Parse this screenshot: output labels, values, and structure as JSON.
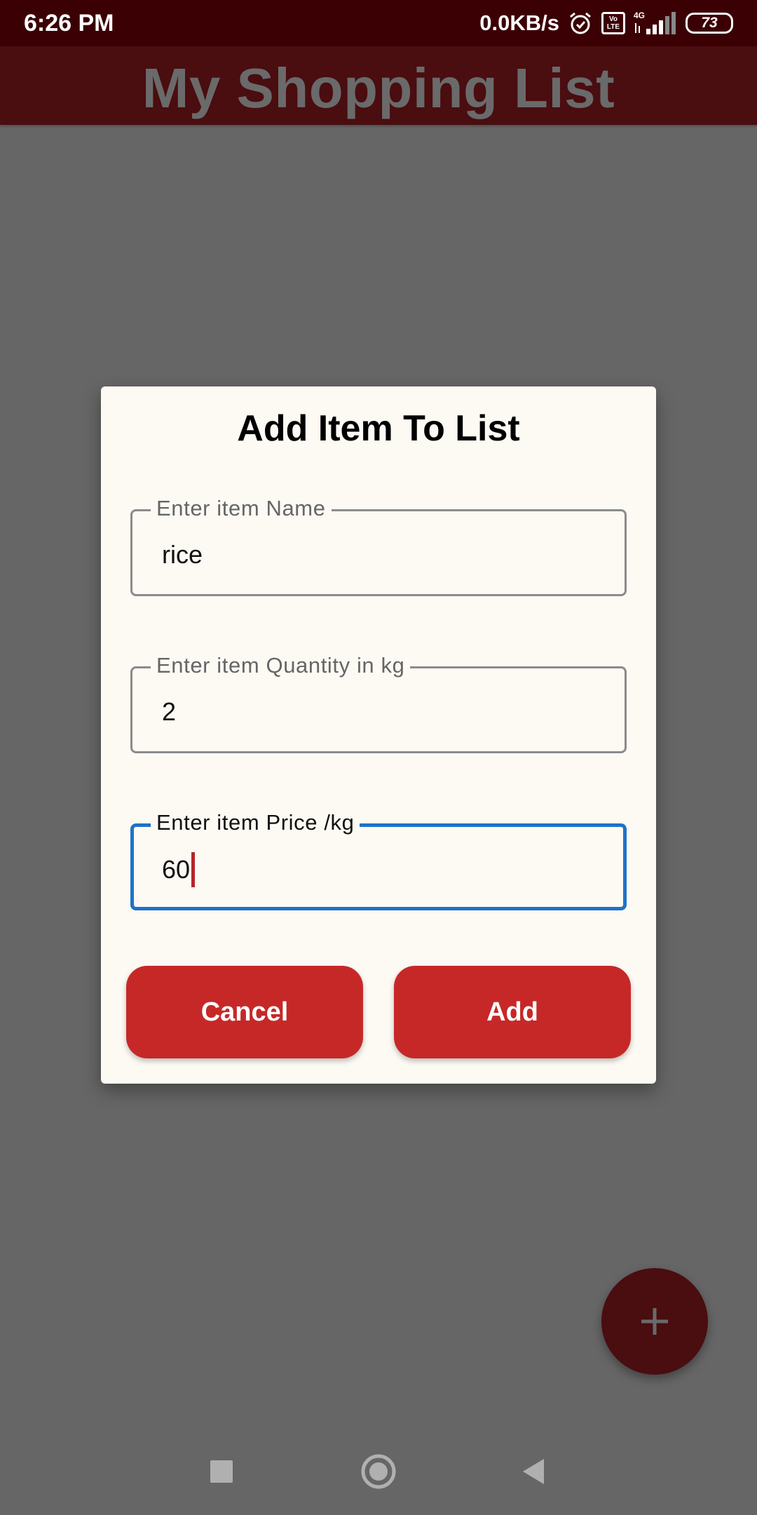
{
  "status_bar": {
    "time": "6:26 PM",
    "net_speed": "0.0KB/s",
    "volte": "Vo LTE",
    "network": "4G",
    "battery": "73",
    "icons": [
      "alarm-icon",
      "volte-icon",
      "signal-icon",
      "battery-icon"
    ]
  },
  "app_bar": {
    "title": "My Shopping List"
  },
  "dialog": {
    "title": "Add Item To List",
    "fields": [
      {
        "label": "Enter item Name",
        "value": "rice"
      },
      {
        "label": "Enter item Quantity in kg",
        "value": "2"
      },
      {
        "label": "Enter item Price /kg",
        "value": "60"
      }
    ],
    "cancel_label": "Cancel",
    "add_label": "Add"
  },
  "fab": {
    "icon": "plus-icon"
  },
  "nav_bar": {
    "icons": [
      "square-icon",
      "circle-icon",
      "back-triangle-icon"
    ]
  },
  "colors": {
    "accent": "#c62828",
    "focus": "#1e72c9",
    "scrim_background": "#666666",
    "dialog_background": "#fdfaf4"
  }
}
